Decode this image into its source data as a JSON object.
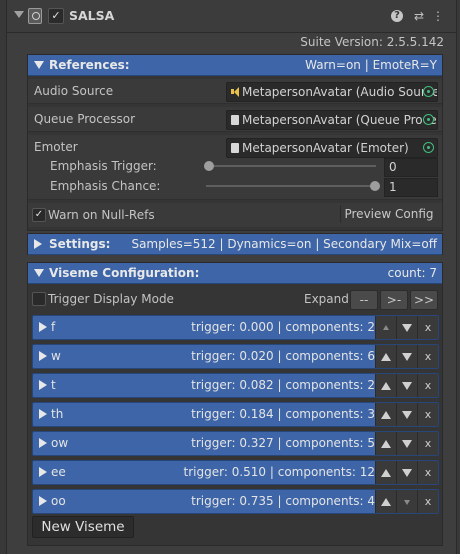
{
  "header": {
    "title": "SALSA",
    "enabled_mark": "✓",
    "help": "?",
    "settings": "⇄",
    "more": "⋮"
  },
  "version": "Suite Version: 2.5.5.142",
  "references": {
    "title": "References:",
    "status": "Warn=on | EmoteR=Y",
    "audio_source": {
      "label": "Audio Source",
      "value": "MetapersonAvatar (Audio Source)"
    },
    "queue_processor": {
      "label": "Queue Processor",
      "value": "MetapersonAvatar (Queue Processor)"
    },
    "emoter": {
      "label": "Emoter",
      "value": "MetapersonAvatar (Emoter)"
    },
    "emphasis_trigger": {
      "label": "Emphasis Trigger:",
      "value": "0",
      "level": 0
    },
    "emphasis_chance": {
      "label": "Emphasis Chance:",
      "value": "1",
      "level": 1
    },
    "warn_null": {
      "label": "Warn on Null-Refs",
      "mark": "✓"
    },
    "preview_config": "Preview Config"
  },
  "settings": {
    "title": "Settings:",
    "summary": "Samples=512 | Dynamics=on | Secondary Mix=off"
  },
  "viseme_config": {
    "title": "Viseme Configuration:",
    "count": "count: 7",
    "trigger_display_mode": "Trigger Display Mode",
    "expand": "Expand",
    "btn_collapse": "--",
    "btn_next": ">-",
    "btn_all": ">>",
    "visemes": [
      {
        "name": "f",
        "info": "trigger: 0.000 | components: 2"
      },
      {
        "name": "w",
        "info": "trigger: 0.020 | components: 6"
      },
      {
        "name": "t",
        "info": "trigger: 0.082 | components: 2"
      },
      {
        "name": "th",
        "info": "trigger: 0.184 | components: 3"
      },
      {
        "name": "ow",
        "info": "trigger: 0.327 | components: 5"
      },
      {
        "name": "ee",
        "info": "trigger: 0.510 | components: 12"
      },
      {
        "name": "oo",
        "info": "trigger: 0.735 | components: 4"
      }
    ],
    "remove": "x",
    "new_viseme": "New Viseme"
  }
}
